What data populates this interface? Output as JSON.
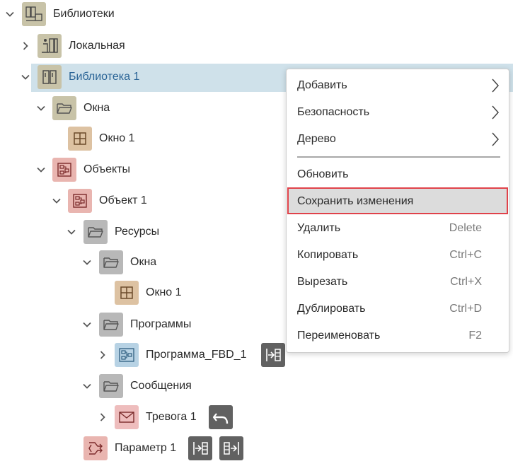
{
  "tree": {
    "root": {
      "label": "Библиотеки"
    },
    "local_lib": {
      "label": "Локальная"
    },
    "library1": {
      "label": "Библиотека 1"
    },
    "windows_folder": {
      "label": "Окна"
    },
    "window1": {
      "label": "Окно 1"
    },
    "objects_folder": {
      "label": "Объекты"
    },
    "object1": {
      "label": "Объект 1"
    },
    "resources_folder": {
      "label": "Ресурсы"
    },
    "res_windows_folder": {
      "label": "Окна"
    },
    "res_window1": {
      "label": "Окно 1"
    },
    "programs_folder": {
      "label": "Программы"
    },
    "program_fbd": {
      "label": "Программа_FBD_1"
    },
    "messages_folder": {
      "label": "Сообщения"
    },
    "alarm1": {
      "label": "Тревога 1"
    },
    "parameter1": {
      "label": "Параметр 1"
    }
  },
  "context_menu": {
    "items": [
      {
        "label": "Добавить",
        "shortcut": "",
        "submenu": true
      },
      {
        "label": "Безопасность",
        "shortcut": "",
        "submenu": true
      },
      {
        "label": "Дерево",
        "shortcut": "",
        "submenu": true
      },
      {
        "label": "Обновить",
        "shortcut": "",
        "submenu": false
      },
      {
        "label": "Сохранить изменения",
        "shortcut": "",
        "submenu": false,
        "highlighted": true
      },
      {
        "label": "Удалить",
        "shortcut": "Delete",
        "submenu": false
      },
      {
        "label": "Копировать",
        "shortcut": "Ctrl+C",
        "submenu": false
      },
      {
        "label": "Вырезать",
        "shortcut": "Ctrl+X",
        "submenu": false
      },
      {
        "label": "Дублировать",
        "shortcut": "Ctrl+D",
        "submenu": false
      },
      {
        "label": "Переименовать",
        "shortcut": "F2",
        "submenu": false
      }
    ]
  },
  "colors": {
    "selection": "#cfe1ea",
    "selected_text": "#2a6496",
    "highlight_border": "#e0424a",
    "tile_library": "#c8c3a8",
    "tile_folder": "#b8b8b8",
    "tile_window": "#ddc2a2",
    "tile_object": "#e9b5b0",
    "tile_program": "#b7d2e4",
    "tile_alarm": "#eebdbd",
    "tile_action": "#616161"
  }
}
